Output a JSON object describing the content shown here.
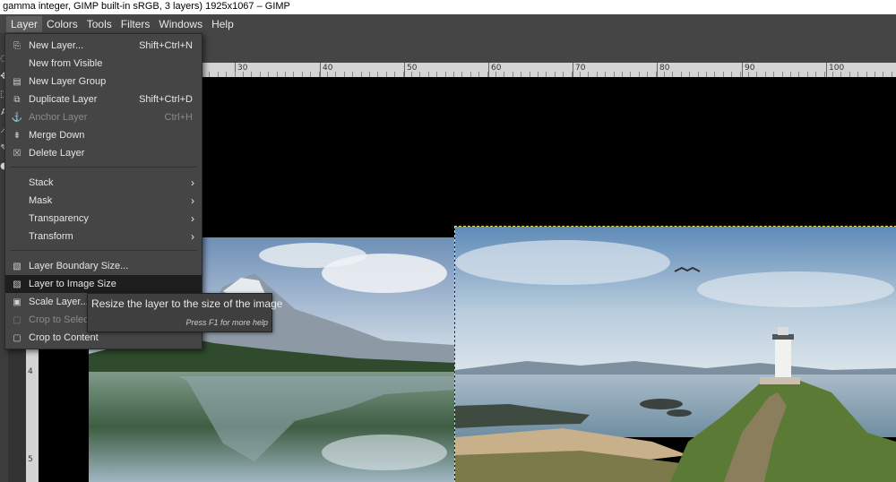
{
  "window": {
    "title": "t gamma integer, GIMP built-in sRGB, 3 layers) 1925x1067 – GIMP"
  },
  "menubar": {
    "items": [
      "Layer",
      "Colors",
      "Tools",
      "Filters",
      "Windows",
      "Help"
    ],
    "active": "Layer"
  },
  "ruler": {
    "labels": [
      "30",
      "40",
      "50",
      "60",
      "70",
      "80",
      "90",
      "100"
    ],
    "vertical_labels": [
      "4",
      "5"
    ]
  },
  "layer_menu": {
    "items": [
      {
        "label": "New Layer...",
        "accel": "Shift+Ctrl+N",
        "icon": "new-layer-icon",
        "glyph": "⎘",
        "enabled": true
      },
      {
        "label": "New from Visible",
        "accel": "",
        "icon": "",
        "glyph": "",
        "enabled": true
      },
      {
        "label": "New Layer Group",
        "accel": "",
        "icon": "layer-group-icon",
        "glyph": "▤",
        "enabled": true
      },
      {
        "label": "Duplicate Layer",
        "accel": "Shift+Ctrl+D",
        "icon": "duplicate-icon",
        "glyph": "⧉",
        "enabled": true
      },
      {
        "label": "Anchor Layer",
        "accel": "Ctrl+H",
        "icon": "anchor-icon",
        "glyph": "⚓",
        "enabled": false
      },
      {
        "label": "Merge Down",
        "accel": "",
        "icon": "merge-down-icon",
        "glyph": "⇟",
        "enabled": true
      },
      {
        "label": "Delete Layer",
        "accel": "",
        "icon": "delete-icon",
        "glyph": "☒",
        "enabled": true
      },
      {
        "label": "Stack",
        "submenu": true
      },
      {
        "label": "Mask",
        "submenu": true
      },
      {
        "label": "Transparency",
        "submenu": true
      },
      {
        "label": "Transform",
        "submenu": true
      },
      {
        "label": "Layer Boundary Size...",
        "accel": "",
        "icon": "boundary-size-icon",
        "glyph": "▧",
        "enabled": true
      },
      {
        "label": "Layer to Image Size",
        "accel": "",
        "icon": "layer-to-image-icon",
        "glyph": "▨",
        "enabled": true,
        "highlighted": true
      },
      {
        "label": "Scale Layer...",
        "accel": "",
        "icon": "scale-layer-icon",
        "glyph": "▣",
        "enabled": true
      },
      {
        "label": "Crop to Selection",
        "accel": "",
        "icon": "crop-selection-icon",
        "glyph": "▢",
        "enabled": false
      },
      {
        "label": "Crop to Content",
        "accel": "",
        "icon": "crop-content-icon",
        "glyph": "▢",
        "enabled": true
      }
    ]
  },
  "tooltip": {
    "text": "Resize the layer to the size of the image",
    "hint": "Press F1 for more help"
  },
  "colors": {
    "menu_bg": "#454545",
    "highlight": "#1e1e1e",
    "selection_border": "#e8e050"
  }
}
